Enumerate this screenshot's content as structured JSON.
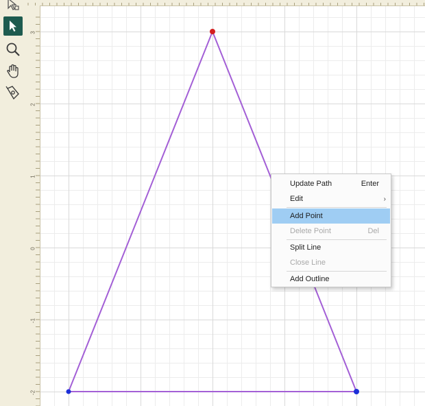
{
  "toolbar": {
    "tools": [
      {
        "icon": "node-select-icon",
        "active": false
      },
      {
        "icon": "pointer-arrow-icon",
        "active": true
      },
      {
        "icon": "magnifier-zoom-icon",
        "active": false
      },
      {
        "icon": "hand-pan-icon",
        "active": false
      },
      {
        "icon": "pen-path-icon",
        "active": false
      }
    ]
  },
  "ruler": {
    "left_labels": [
      "3",
      "2",
      "1",
      "0",
      "-1",
      "-2"
    ]
  },
  "canvas": {
    "shape": "triangle",
    "line_color": "#a35fd6",
    "point_colors": {
      "selected": "#d41f1f",
      "normal": "#1c2fd8"
    }
  },
  "context_menu": {
    "items": [
      {
        "label": "Update Path",
        "shortcut": "Enter",
        "state": "normal"
      },
      {
        "label": "Edit",
        "shortcut": "",
        "state": "normal",
        "submenu": true,
        "submenu_glyph": "›"
      },
      {
        "label": "Add Point",
        "shortcut": "",
        "state": "highlighted"
      },
      {
        "label": "Delete Point",
        "shortcut": "Del",
        "state": "disabled"
      },
      {
        "label": "Split Line",
        "shortcut": "",
        "state": "normal"
      },
      {
        "label": "Close Line",
        "shortcut": "",
        "state": "disabled"
      },
      {
        "label": "Add Outline",
        "shortcut": "",
        "state": "normal"
      }
    ]
  }
}
